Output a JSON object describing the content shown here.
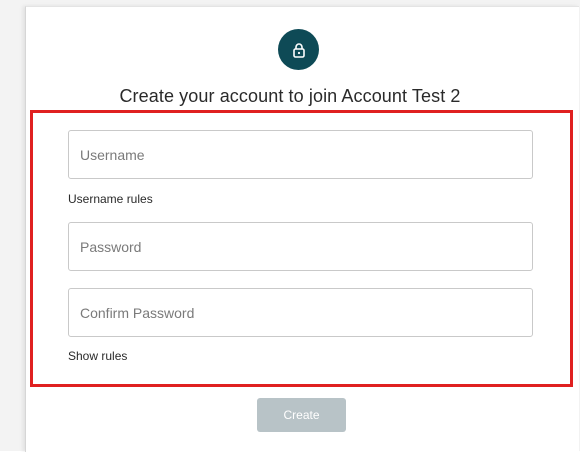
{
  "header": {
    "icon": "lock-icon",
    "title": "Create your account to join Account Test 2"
  },
  "form": {
    "username_placeholder": "Username",
    "username_rules_label": "Username rules",
    "password_placeholder": "Password",
    "confirm_password_placeholder": "Confirm Password",
    "show_rules_label": "Show rules",
    "create_label": "Create"
  },
  "colors": {
    "accent": "#0e4a56",
    "highlight_border": "#e02020",
    "button_disabled": "#b8c3c7"
  }
}
